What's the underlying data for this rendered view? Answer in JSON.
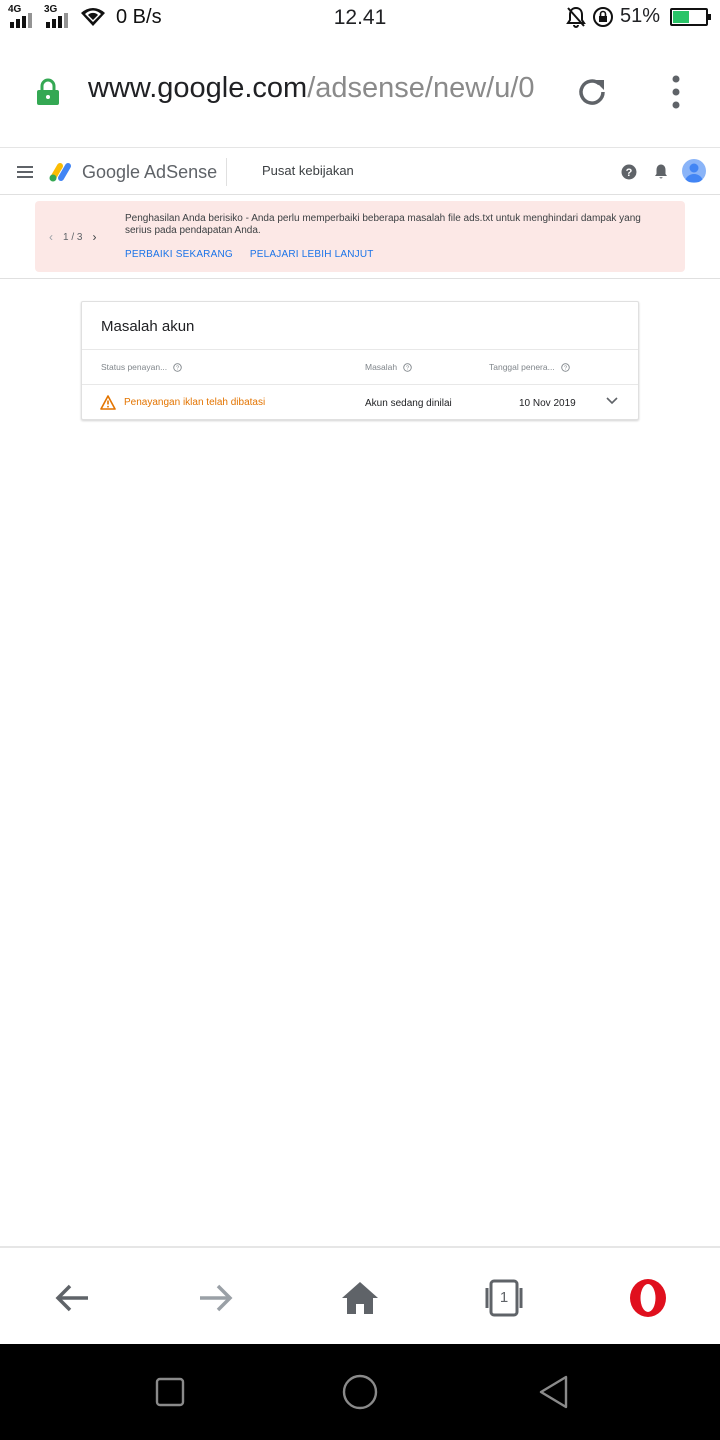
{
  "status_bar": {
    "net_1": "4G",
    "net_2": "3G",
    "speed": "0 B/s",
    "time": "12.41",
    "battery_percent": "51%",
    "battery_level": 0.51,
    "battery_color": "#29c467"
  },
  "browser": {
    "url_host": "www.google.com",
    "url_path": "/adsense/new/u/0",
    "lock_color": "#34a853"
  },
  "header": {
    "brand": "Google AdSense",
    "title": "Pusat kebijakan"
  },
  "banner": {
    "pager": "1 / 3",
    "message": "Penghasilan Anda berisiko - Anda perlu memperbaiki beberapa masalah file ads.txt untuk menghindari dampak yang serius pada pendapatan Anda.",
    "action_fix": "PERBAIKI SEKARANG",
    "action_learn": "PELAJARI LEBIH LANJUT",
    "background_color": "#fce8e6",
    "link_color": "#1a73e8"
  },
  "account_issues": {
    "title": "Masalah akun",
    "columns": [
      "Status penayan...",
      "Masalah",
      "Tanggal penera..."
    ],
    "rows": [
      {
        "status": "Penayangan iklan telah dibatasi",
        "issue": "Akun sedang dinilai",
        "date": "10 Nov 2019"
      }
    ],
    "status_color": "#e37400"
  },
  "bottom_toolbar": {
    "tabs_count": "1",
    "icons": [
      "back-icon",
      "forward-icon",
      "home-icon",
      "tabs-icon",
      "opera-menu-icon"
    ]
  },
  "nav_bar": {
    "icons": [
      "recent-apps-icon",
      "home-circle-icon",
      "back-triangle-icon"
    ]
  }
}
